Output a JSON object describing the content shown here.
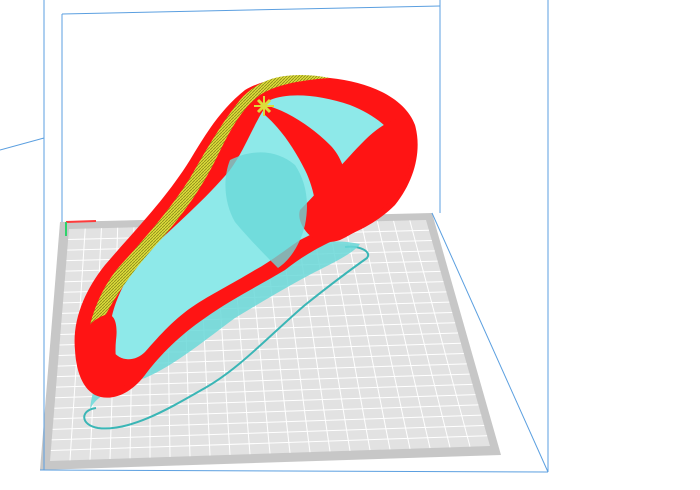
{
  "viewer": {
    "background_color": "#ffffff",
    "build_volume_line_color": "#5b9fe0",
    "bed_color": "#e2e2e2",
    "bed_border_color": "#c7c7c7",
    "bed_grid_color": "#ffffff",
    "axis_x_color": "#ff3a3a",
    "axis_y_color": "#2fd36b",
    "model": {
      "outer_wall_color": "#ff1414",
      "inner_wall_color": "#dcdc3a",
      "support_color": "#6ad8d8",
      "infill_color": "#8ee9e9",
      "skirt_color": "#3ab6b6"
    }
  }
}
